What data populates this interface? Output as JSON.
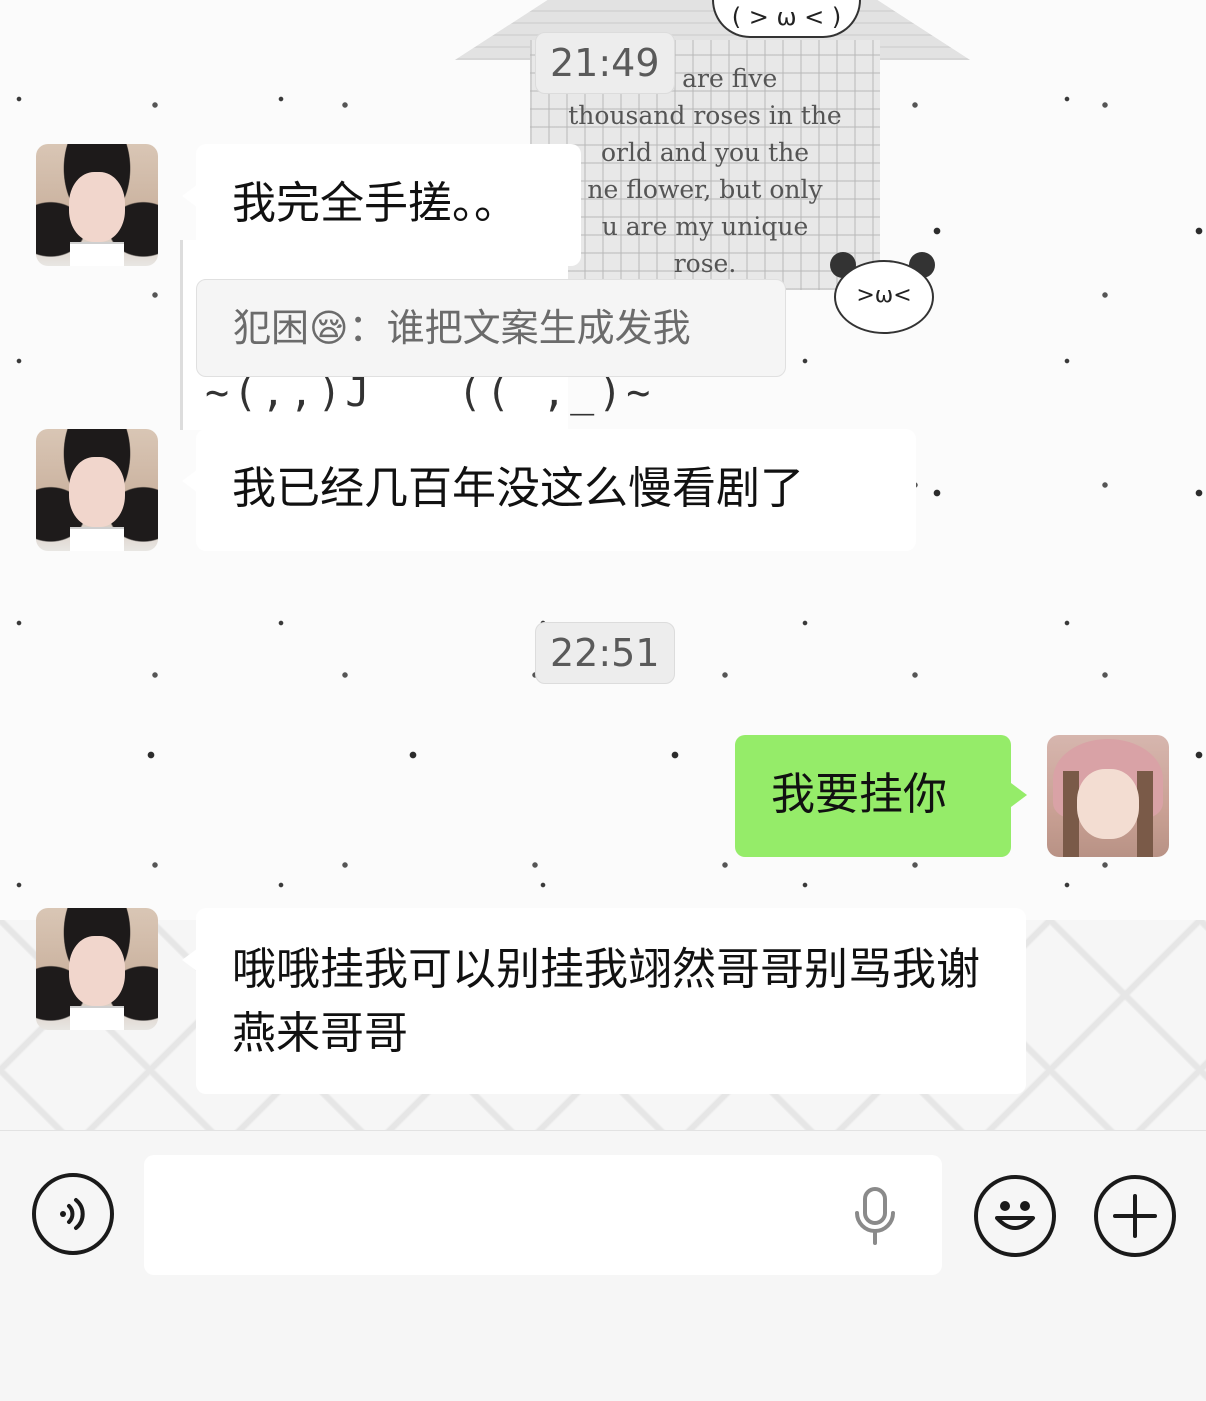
{
  "wallpaper": {
    "kaomoji": "( > ω < )",
    "house_text_lines": [
      "ere are five",
      "thousand roses in the",
      "orld and you the",
      "ne flower, but only",
      "u are my unique",
      "rose."
    ],
    "panda_face": ">ω<"
  },
  "timestamps": [
    "21:49",
    "22:51"
  ],
  "messages": {
    "m1": "我完全手搓。。",
    "quote": "犯困😪：谁把文案生成发我",
    "m2": "我已经几百年没这么慢看剧了",
    "m3": "我要挂你",
    "m4": "哦哦挂我可以别挂我翊然哥哥别骂我谢燕来哥哥"
  },
  "input": {
    "value": "",
    "placeholder": ""
  },
  "icons": {
    "voice": "voice-icon",
    "mic": "microphone-icon",
    "emoji": "emoji-icon",
    "add": "plus-icon"
  },
  "colors": {
    "sent_bubble": "#95ec69",
    "received_bubble": "#ffffff",
    "toolbar_bg": "#f6f6f6"
  }
}
